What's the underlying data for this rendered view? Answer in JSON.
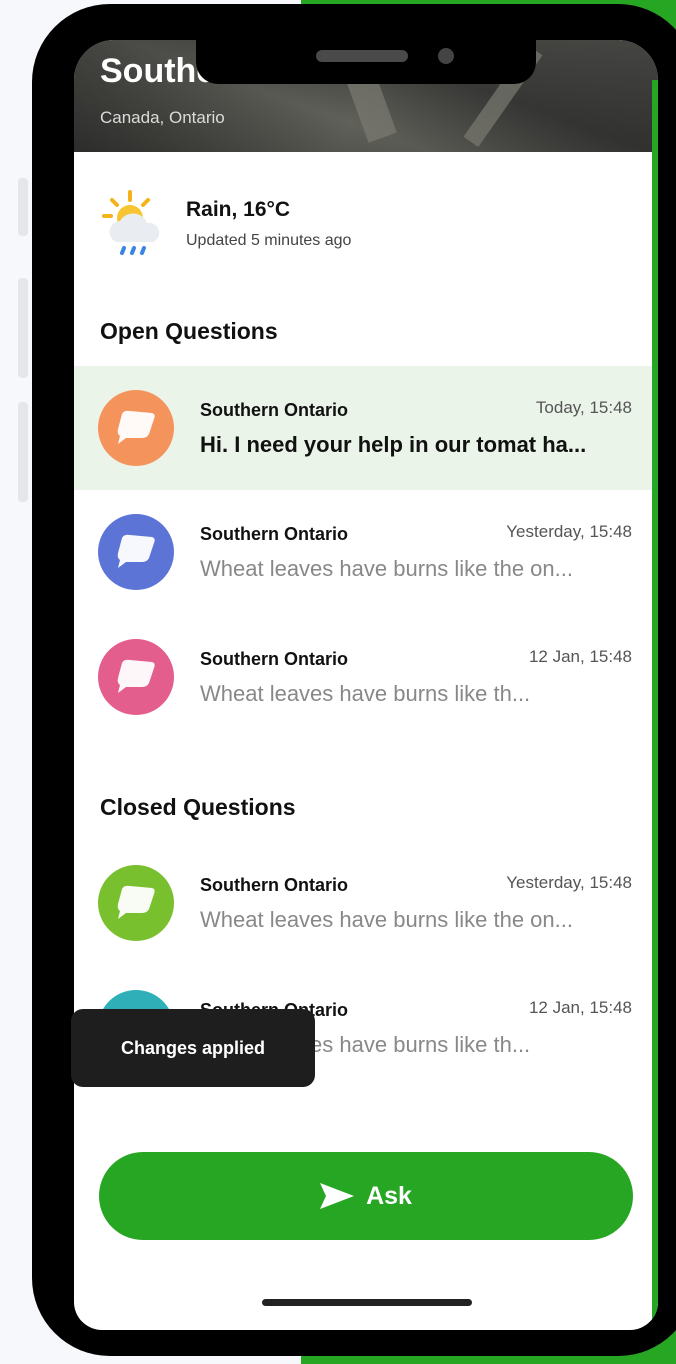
{
  "header": {
    "title": "Southern Ontario",
    "subtitle": "Canada, Ontario"
  },
  "weather": {
    "icon": "cloud-sun-rain-icon",
    "condition": "Rain, 16°C",
    "updated": "Updated 5 minutes ago"
  },
  "open_questions": {
    "title": "Open Questions",
    "items": [
      {
        "name": "Southern Ontario",
        "time": "Today, 15:48",
        "text": "Hi. I need your help in our tomat ha...",
        "color": "#f5935d",
        "active": true
      },
      {
        "name": "Southern Ontario",
        "time": "Yesterday, 15:48",
        "text": "Wheat leaves have burns like the on...",
        "color": "#5b74d6"
      },
      {
        "name": "Southern Ontario",
        "time": "12 Jan, 15:48",
        "text": "Wheat leaves have burns like th...",
        "color": "#e35e8c"
      }
    ]
  },
  "closed_questions": {
    "title": "Closed Questions",
    "items": [
      {
        "name": "Southern Ontario",
        "time": "Yesterday, 15:48",
        "text": "Wheat leaves have burns like the on...",
        "color": "#79c02e"
      },
      {
        "name": "Southern Ontario",
        "time": "12 Jan, 15:48",
        "text": "Wheat leaves have burns like th...",
        "color": "#2fb0b8"
      }
    ]
  },
  "toast": {
    "text": "Changes applied"
  },
  "ask_button": {
    "label": "Ask",
    "icon": "send-icon"
  },
  "colors": {
    "accent": "#27a624"
  }
}
